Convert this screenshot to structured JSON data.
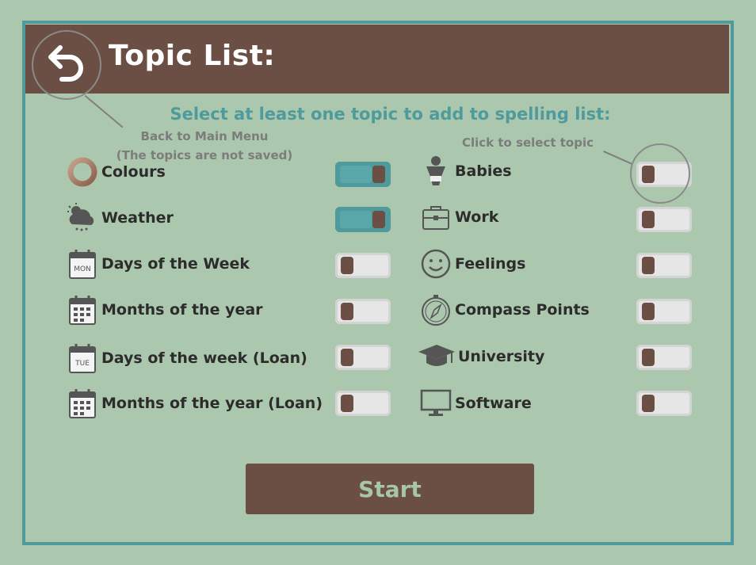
{
  "header": {
    "title": "Topic List:"
  },
  "instruction": "Select at least one topic to add to spelling list:",
  "hints": {
    "back_line1": "Back to Main Menu",
    "back_line2": "(The topics are not saved)",
    "select": "Click to select topic"
  },
  "topics_left": [
    {
      "label": "Colours",
      "icon": "colour-ring-icon",
      "selected": true
    },
    {
      "label": "Weather",
      "icon": "cloud-sun-rain-icon",
      "selected": true
    },
    {
      "label": "Days of the Week",
      "icon": "calendar-day-icon",
      "icon_text": "MON",
      "selected": false
    },
    {
      "label": "Months of the year",
      "icon": "calendar-grid-icon",
      "selected": false
    },
    {
      "label": "Days of the week (Loan)",
      "icon": "calendar-day-icon",
      "icon_text": "TUE",
      "selected": false
    },
    {
      "label": "Months of the year (Loan)",
      "icon": "calendar-grid-icon",
      "selected": false
    }
  ],
  "topics_right": [
    {
      "label": "Babies",
      "icon": "baby-icon",
      "selected": false
    },
    {
      "label": "Work",
      "icon": "briefcase-icon",
      "selected": false
    },
    {
      "label": "Feelings",
      "icon": "smiley-icon",
      "selected": false
    },
    {
      "label": "Compass Points",
      "icon": "compass-icon",
      "selected": false
    },
    {
      "label": "University",
      "icon": "graduation-cap-icon",
      "selected": false
    },
    {
      "label": "Software",
      "icon": "monitor-icon",
      "selected": false
    }
  ],
  "start_button": "Start",
  "colors": {
    "background": "#abc8ae",
    "header": "#6b4e44",
    "accent": "#4e9a9c",
    "start_text": "#a6c6a6"
  }
}
